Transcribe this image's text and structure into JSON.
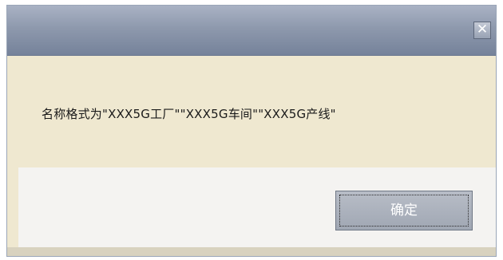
{
  "dialog": {
    "title": "",
    "close_glyph": "✕",
    "close_icon": "close-icon",
    "message": "名称格式为\"XXX5G工厂\"\"XXX5G车间\"\"XXX5G产线\"",
    "ok_label": "确定"
  }
}
